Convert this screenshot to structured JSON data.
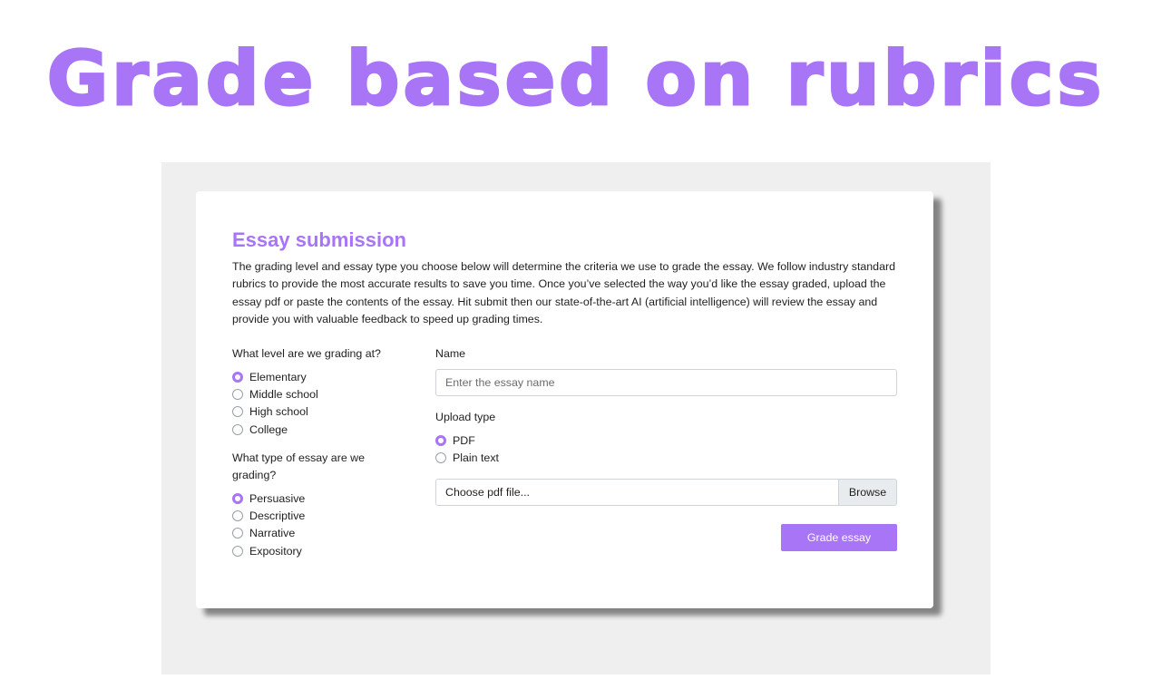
{
  "hero": {
    "title": "Grade based on rubrics"
  },
  "form": {
    "title": "Essay submission",
    "description": "The grading level and essay type you choose below will determine the criteria we use to grade the essay. We follow industry standard rubrics to provide the most accurate results to save you time. Once you’ve selected the way you’d like the essay graded, upload the essay pdf or paste the contents of the essay. Hit submit then our state-of-the-art AI (artificial intelligence) will review the essay and provide you with valuable feedback to speed up grading times.",
    "level": {
      "label": "What level are we grading at?",
      "options": [
        "Elementary",
        "Middle school",
        "High school",
        "College"
      ],
      "selected": "Elementary"
    },
    "essay_type": {
      "label": "What type of essay are we grading?",
      "options": [
        "Persuasive",
        "Descriptive",
        "Narrative",
        "Expository"
      ],
      "selected": "Persuasive"
    },
    "name": {
      "label": "Name",
      "placeholder": "Enter the essay name",
      "value": ""
    },
    "upload_type": {
      "label": "Upload type",
      "options": [
        "PDF",
        "Plain text"
      ],
      "selected": "PDF"
    },
    "file": {
      "placeholder": "Choose pdf file...",
      "browse_label": "Browse"
    },
    "submit_label": "Grade essay"
  },
  "colors": {
    "accent": "#a875f7",
    "backdrop": "#efefef",
    "text": "#1f1f1f"
  }
}
